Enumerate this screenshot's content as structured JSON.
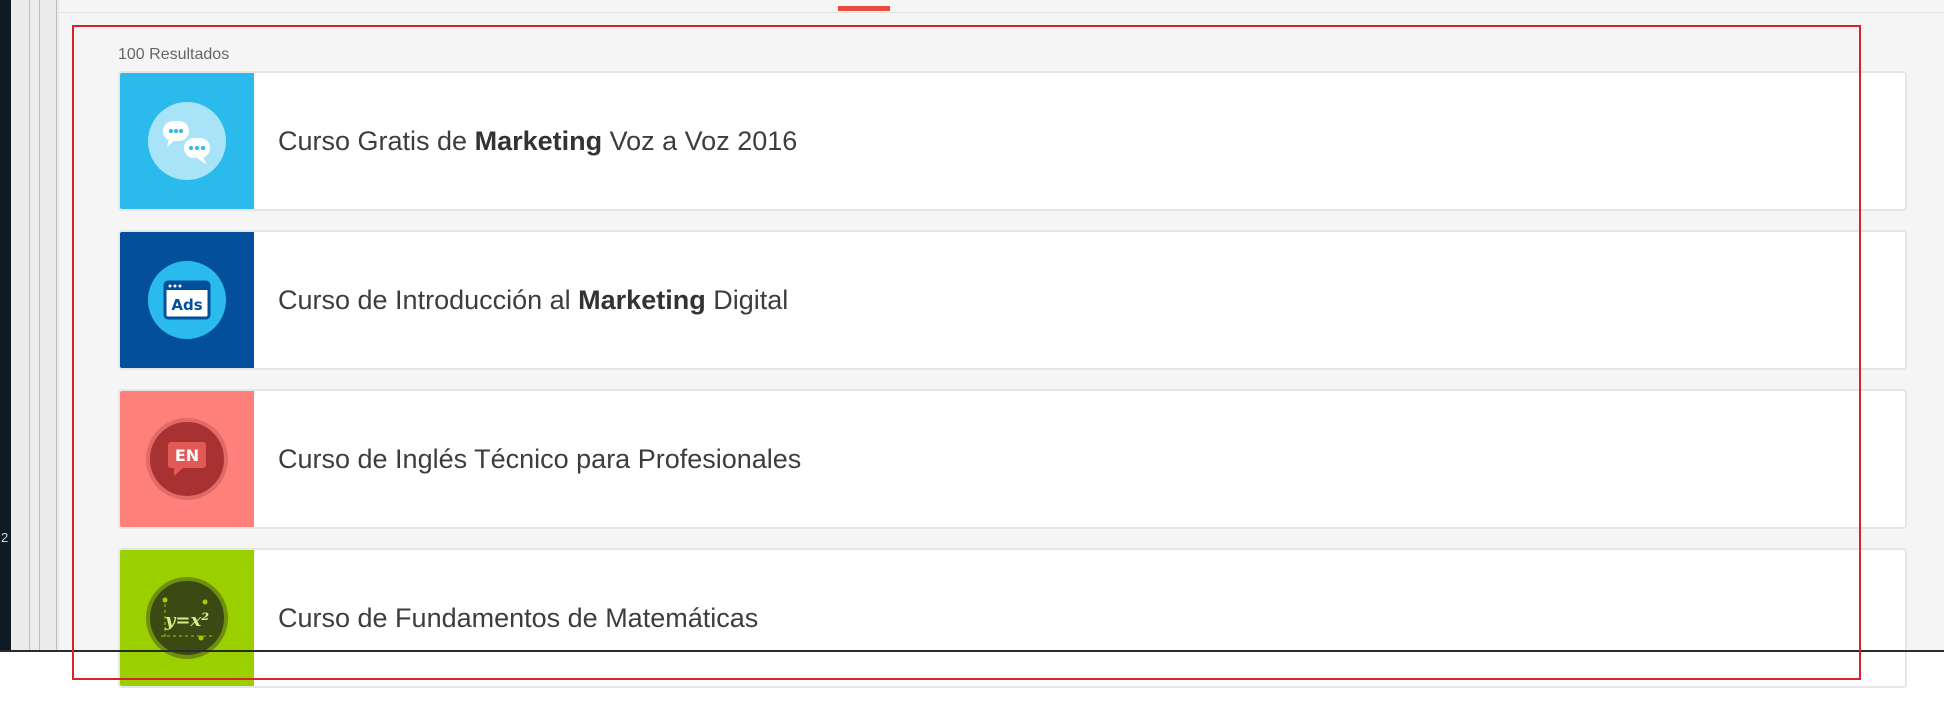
{
  "left_panel": {
    "mark_text": "2"
  },
  "results": {
    "count_label": "100 Resultados",
    "courses": [
      {
        "pre": "Curso Gratis de ",
        "bold": "Marketing",
        "post": " Voz a Voz 2016",
        "thumb_color": "#2abbec",
        "icon": "chat-bubbles-icon"
      },
      {
        "pre": "Curso de Introducción al ",
        "bold": "Marketing",
        "post": " Digital",
        "thumb_color": "#034f9c",
        "icon": "ads-browser-icon",
        "icon_text": "Ads"
      },
      {
        "pre": "Curso de Inglés Técnico para Profesionales",
        "bold": "",
        "post": "",
        "thumb_color": "#ff7f7b",
        "icon": "english-speech-bubble-icon",
        "icon_text": "EN"
      },
      {
        "pre": "Curso de Fundamentos de Matemáticas",
        "bold": "",
        "post": "",
        "thumb_color": "#9acf00",
        "icon": "math-equation-icon",
        "icon_text": "y=x²"
      }
    ]
  },
  "colors": {
    "accent_tab": "#e74c3c",
    "highlight_box": "#d6252a"
  }
}
